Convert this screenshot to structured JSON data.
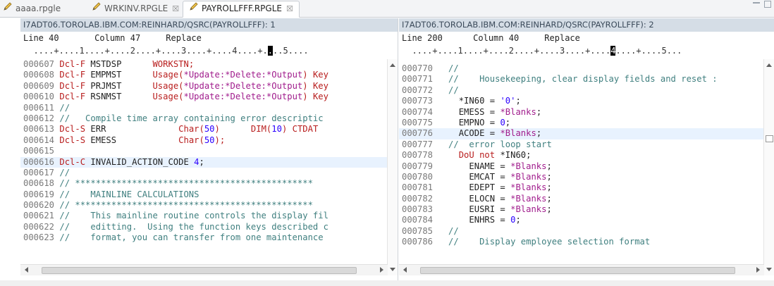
{
  "tabs": [
    {
      "label": "aaaa.rpgle",
      "closable": false
    },
    {
      "label": "WRKINV.RPGLE",
      "closable": true,
      "close_glyph": "☒"
    },
    {
      "label": "PAYROLLFFF.RPGLE",
      "closable": true,
      "close_glyph": "☒"
    }
  ],
  "left": {
    "title": "I7ADT06.TOROLAB.IBM.COM:REINHARD/QSRC(PAYROLLFFF): 1",
    "status": "Line 40       Column 47     Replace",
    "ruler_pre": "  ....+....1....+....2....+....3....+....4....+.",
    "ruler_cursor": ".",
    "ruler_post": "..5....",
    "lines": [
      {
        "seq": "000607",
        "parts": [
          [
            "kw",
            "Dcl-F "
          ],
          [
            "tx",
            "MSTDSP      "
          ],
          [
            "kw",
            "WORKSTN;"
          ]
        ]
      },
      {
        "seq": "000608",
        "parts": [
          [
            "kw",
            "Dcl-F "
          ],
          [
            "tx",
            "EMPMST      "
          ],
          [
            "kw",
            "Usage("
          ],
          [
            "fn",
            "*Update:*Delete:*Output"
          ],
          [
            "kw",
            ") Key"
          ]
        ]
      },
      {
        "seq": "000609",
        "parts": [
          [
            "kw",
            "Dcl-F "
          ],
          [
            "tx",
            "PRJMST      "
          ],
          [
            "kw",
            "Usage("
          ],
          [
            "fn",
            "*Update:*Delete:*Output"
          ],
          [
            "kw",
            ") Key"
          ]
        ]
      },
      {
        "seq": "000610",
        "parts": [
          [
            "kw",
            "Dcl-F "
          ],
          [
            "tx",
            "RSNMST      "
          ],
          [
            "kw",
            "Usage("
          ],
          [
            "fn",
            "*Update:*Delete:*Output"
          ],
          [
            "kw",
            ") Key"
          ]
        ]
      },
      {
        "seq": "000611",
        "parts": [
          [
            "cm",
            "//"
          ]
        ]
      },
      {
        "seq": "000612",
        "parts": [
          [
            "cm",
            "//   Compile time array containing error descriptic"
          ]
        ]
      },
      {
        "seq": "000613",
        "parts": [
          [
            "kw",
            "Dcl-S "
          ],
          [
            "tx",
            "ERR              "
          ],
          [
            "kw",
            "Char("
          ],
          [
            "num",
            "50"
          ],
          [
            "kw",
            ")      DIM("
          ],
          [
            "num",
            "10"
          ],
          [
            "kw",
            ") CTDAT"
          ]
        ]
      },
      {
        "seq": "000614",
        "parts": [
          [
            "kw",
            "Dcl-S "
          ],
          [
            "tx",
            "EMESS            "
          ],
          [
            "kw",
            "Char("
          ],
          [
            "num",
            "50"
          ],
          [
            "kw",
            ");"
          ]
        ]
      },
      {
        "seq": "000615",
        "parts": []
      },
      {
        "seq": "000616",
        "hl": true,
        "parts": [
          [
            "kw",
            "Dcl-C "
          ],
          [
            "tx",
            "INVALID_ACTION_CODE "
          ],
          [
            "num",
            "4"
          ],
          [
            "tx",
            ";"
          ]
        ]
      },
      {
        "seq": "000617",
        "parts": [
          [
            "cm",
            "//"
          ]
        ]
      },
      {
        "seq": "000618",
        "parts": [
          [
            "cm",
            "// **********************************************"
          ]
        ]
      },
      {
        "seq": "000619",
        "parts": [
          [
            "cm",
            "//    MAINLINE CALCULATIONS"
          ]
        ]
      },
      {
        "seq": "000620",
        "parts": [
          [
            "cm",
            "// **********************************************"
          ]
        ]
      },
      {
        "seq": "000621",
        "parts": [
          [
            "cm",
            "//    This mainline routine controls the display fil"
          ]
        ]
      },
      {
        "seq": "000622",
        "parts": [
          [
            "cm",
            "//    editting.  Using the function keys described c"
          ]
        ]
      },
      {
        "seq": "000623",
        "parts": [
          [
            "cm",
            "//    format, you can transfer from one maintenance"
          ]
        ]
      }
    ]
  },
  "right": {
    "title": "I7ADT06.TOROLAB.IBM.COM:REINHARD/QSRC(PAYROLLFFF): 2",
    "status": "Line 200      Column 40     Replace",
    "ruler_pre": "  ....+....1....+....2....+....3....+....",
    "ruler_cursor": "4",
    "ruler_post": "....+....5...",
    "lines": [
      {
        "seq": "000770",
        "parts": [
          [
            "cm",
            "  //"
          ]
        ]
      },
      {
        "seq": "000771",
        "parts": [
          [
            "cm",
            "  //    Housekeeping, clear display fields and reset :"
          ]
        ]
      },
      {
        "seq": "000772",
        "parts": [
          [
            "cm",
            "  //"
          ]
        ]
      },
      {
        "seq": "000773",
        "parts": [
          [
            "tx",
            "    *IN60 = "
          ],
          [
            "str",
            "'0'"
          ],
          [
            "tx",
            ";"
          ]
        ]
      },
      {
        "seq": "000774",
        "parts": [
          [
            "tx",
            "    EMESS = "
          ],
          [
            "fn",
            "*Blanks"
          ],
          [
            "tx",
            ";"
          ]
        ]
      },
      {
        "seq": "000775",
        "parts": [
          [
            "tx",
            "    EMPNO = "
          ],
          [
            "num",
            "0"
          ],
          [
            "tx",
            ";"
          ]
        ]
      },
      {
        "seq": "000776",
        "hl": true,
        "parts": [
          [
            "tx",
            "    ACODE = "
          ],
          [
            "fn",
            "*Blanks"
          ],
          [
            "tx",
            ";"
          ]
        ]
      },
      {
        "seq": "000777",
        "parts": [
          [
            "cm",
            "  //  error loop start"
          ]
        ]
      },
      {
        "seq": "000778",
        "parts": [
          [
            "kw",
            "    DoU not "
          ],
          [
            "tx",
            "*IN60;"
          ]
        ]
      },
      {
        "seq": "000779",
        "parts": [
          [
            "tx",
            "      ENAME = "
          ],
          [
            "fn",
            "*Blanks"
          ],
          [
            "tx",
            ";"
          ]
        ]
      },
      {
        "seq": "000780",
        "parts": [
          [
            "tx",
            "      EMCAT = "
          ],
          [
            "fn",
            "*Blanks"
          ],
          [
            "tx",
            ";"
          ]
        ]
      },
      {
        "seq": "000781",
        "parts": [
          [
            "tx",
            "      EDEPT = "
          ],
          [
            "fn",
            "*Blanks"
          ],
          [
            "tx",
            ";"
          ]
        ]
      },
      {
        "seq": "000782",
        "parts": [
          [
            "tx",
            "      ELOCN = "
          ],
          [
            "fn",
            "*Blanks"
          ],
          [
            "tx",
            ";"
          ]
        ]
      },
      {
        "seq": "000783",
        "parts": [
          [
            "tx",
            "      EUSRI = "
          ],
          [
            "fn",
            "*Blanks"
          ],
          [
            "tx",
            ";"
          ]
        ]
      },
      {
        "seq": "000784",
        "parts": [
          [
            "tx",
            "      ENHRS = "
          ],
          [
            "num",
            "0"
          ],
          [
            "tx",
            ";"
          ]
        ]
      },
      {
        "seq": "000785",
        "parts": [
          [
            "cm",
            "  //"
          ]
        ]
      },
      {
        "seq": "000786",
        "parts": [
          [
            "cm",
            "  //    Display employee selection format"
          ]
        ]
      }
    ]
  },
  "colors": {
    "keyword": "#b81d1d",
    "comment": "#3f7f7f",
    "special": "#a01c8c",
    "literal": "#2a00ff",
    "title_bar": "#d5dde6",
    "highlight_line": "#e8f2fe"
  },
  "icons": {
    "tab_edit": "pencil-icon",
    "tab_close": "close-icon",
    "scroll_up": "chevron-up-icon",
    "scroll_down": "chevron-down-icon",
    "overview": "overview-ruler-icon"
  }
}
